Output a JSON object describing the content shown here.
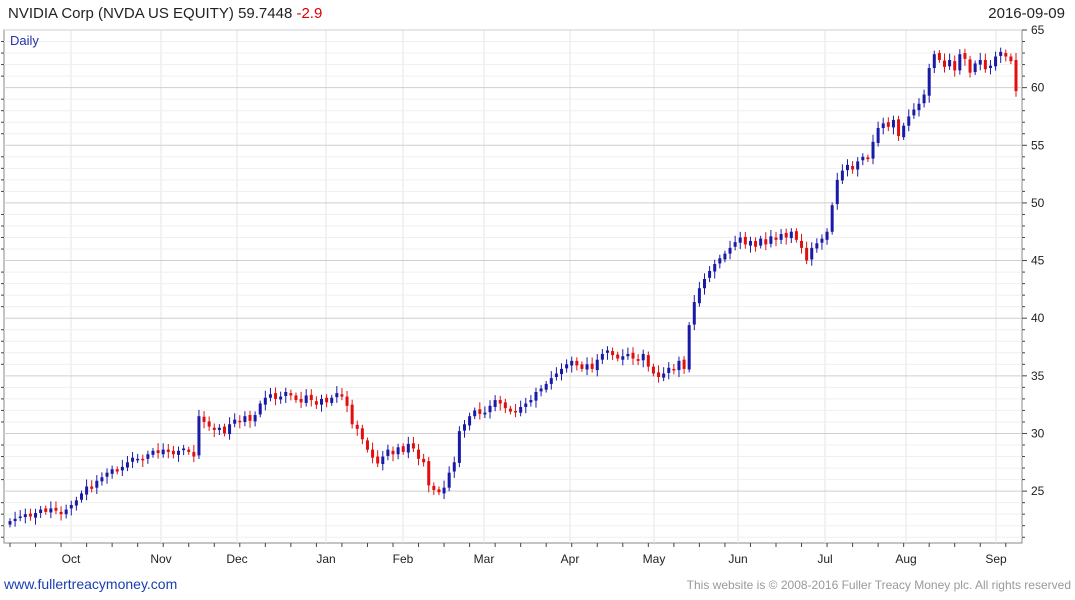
{
  "header": {
    "title": "NVIDIA Corp (NVDA US EQUITY)",
    "last_price": "59.7448",
    "change": "-2.9",
    "date": "2016-09-09"
  },
  "footer": {
    "site": "www.fullertreacymoney.com",
    "copyright": "This website is © 2008-2016 Fuller Treacy Money plc. All rights reserved"
  },
  "colors": {
    "up": "#1a1aa8",
    "down": "#e01010",
    "grid": "#d8d8d8"
  },
  "chart_data": {
    "type": "candlestick",
    "period_label": "Daily",
    "ylim": [
      20.5,
      65
    ],
    "y_ticks": [
      25,
      30,
      35,
      40,
      45,
      50,
      55,
      60,
      65
    ],
    "x_months": [
      "Oct",
      "Nov",
      "Dec",
      "Jan",
      "Feb",
      "Mar",
      "Apr",
      "May",
      "Jun",
      "Jul",
      "Aug",
      "Sep"
    ],
    "closes": [
      22.4,
      22.6,
      22.8,
      23.0,
      22.8,
      23.1,
      23.4,
      23.2,
      23.5,
      23.3,
      23.0,
      23.4,
      23.8,
      24.2,
      24.8,
      25.4,
      25.2,
      25.9,
      26.2,
      26.6,
      26.9,
      26.7,
      27.1,
      27.5,
      27.9,
      27.8,
      27.7,
      28.2,
      28.5,
      28.3,
      28.6,
      28.4,
      28.2,
      28.5,
      28.7,
      28.4,
      28.0,
      31.5,
      31.0,
      30.6,
      30.3,
      30.5,
      30.0,
      30.8,
      31.2,
      31.0,
      31.5,
      31.1,
      31.6,
      32.6,
      33.1,
      33.4,
      33.0,
      33.2,
      33.6,
      33.3,
      32.9,
      32.7,
      33.3,
      32.9,
      32.5,
      33.0,
      32.7,
      33.1,
      33.5,
      33.2,
      32.4,
      30.8,
      30.4,
      29.5,
      28.6,
      27.9,
      27.4,
      28.0,
      28.6,
      28.2,
      28.8,
      28.4,
      29.1,
      28.7,
      27.8,
      27.5,
      25.5,
      25.1,
      24.9,
      25.3,
      26.6,
      27.5,
      30.2,
      30.8,
      31.5,
      32.0,
      31.7,
      31.8,
      32.4,
      32.9,
      32.6,
      32.2,
      31.9,
      31.9,
      32.3,
      32.6,
      32.9,
      33.6,
      33.9,
      34.3,
      34.8,
      35.2,
      35.6,
      36.0,
      36.3,
      35.9,
      35.6,
      36.0,
      35.6,
      36.4,
      36.9,
      37.2,
      36.8,
      36.5,
      36.7,
      36.9,
      36.5,
      36.3,
      36.9,
      35.8,
      35.2,
      34.9,
      35.2,
      35.7,
      35.5,
      36.3,
      35.6,
      39.4,
      41.4,
      42.6,
      43.4,
      44.1,
      44.7,
      45.2,
      45.6,
      46.1,
      46.6,
      47.0,
      46.4,
      46.7,
      46.2,
      46.9,
      46.4,
      47.1,
      46.8,
      47.3,
      47.0,
      47.5,
      46.8,
      46.1,
      45.0,
      46.1,
      46.5,
      46.9,
      47.5,
      49.8,
      52.0,
      52.8,
      53.3,
      52.9,
      53.6,
      54.0,
      53.8,
      55.3,
      56.5,
      56.9,
      56.6,
      57.2,
      55.8,
      56.7,
      57.5,
      58.1,
      58.6,
      59.4,
      61.7,
      62.9,
      62.4,
      61.8,
      62.4,
      61.5,
      62.9,
      62.5,
      61.3,
      62.1,
      62.4,
      61.6,
      61.9,
      62.7,
      63.1,
      62.7,
      62.3,
      59.7
    ]
  }
}
